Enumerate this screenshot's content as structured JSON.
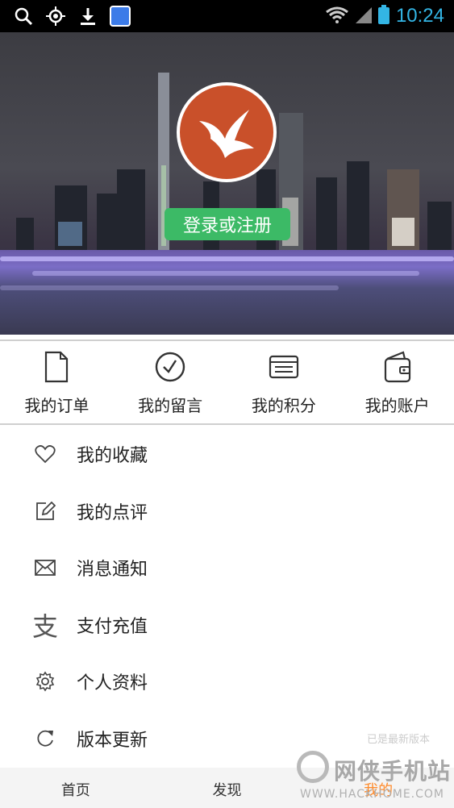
{
  "status_bar": {
    "time": "10:24",
    "icons_left": [
      "search-icon",
      "gps-icon",
      "download-icon",
      "baidu-icon"
    ],
    "icons_right": [
      "wifi-icon",
      "signal-icon",
      "battery-icon"
    ]
  },
  "hero": {
    "login_label": "登录或注册"
  },
  "quick_actions": [
    {
      "label": "我的订单",
      "icon": "document-icon"
    },
    {
      "label": "我的留言",
      "icon": "clock-icon"
    },
    {
      "label": "我的积分",
      "icon": "card-icon"
    },
    {
      "label": "我的账户",
      "icon": "wallet-icon"
    }
  ],
  "menu": [
    {
      "label": "我的收藏",
      "icon": "heart-icon"
    },
    {
      "label": "我的点评",
      "icon": "edit-icon"
    },
    {
      "label": "消息通知",
      "icon": "mail-icon"
    },
    {
      "label": "支付充值",
      "icon": "pay-icon",
      "glyph": "支"
    },
    {
      "label": "个人资料",
      "icon": "gear-icon"
    },
    {
      "label": "版本更新",
      "icon": "refresh-icon",
      "extra": "已是最新版本"
    }
  ],
  "tabs": [
    {
      "label": "首页"
    },
    {
      "label": "发现"
    },
    {
      "label": "我的"
    }
  ],
  "watermark": {
    "name": "网侠手机站",
    "url": "WWW.HACKHOME.COM"
  },
  "colors": {
    "accent_green": "#3cba66",
    "active_tab": "#ff8a2a",
    "avatar_bg": "#c9502a",
    "status_time": "#33b5e5"
  }
}
